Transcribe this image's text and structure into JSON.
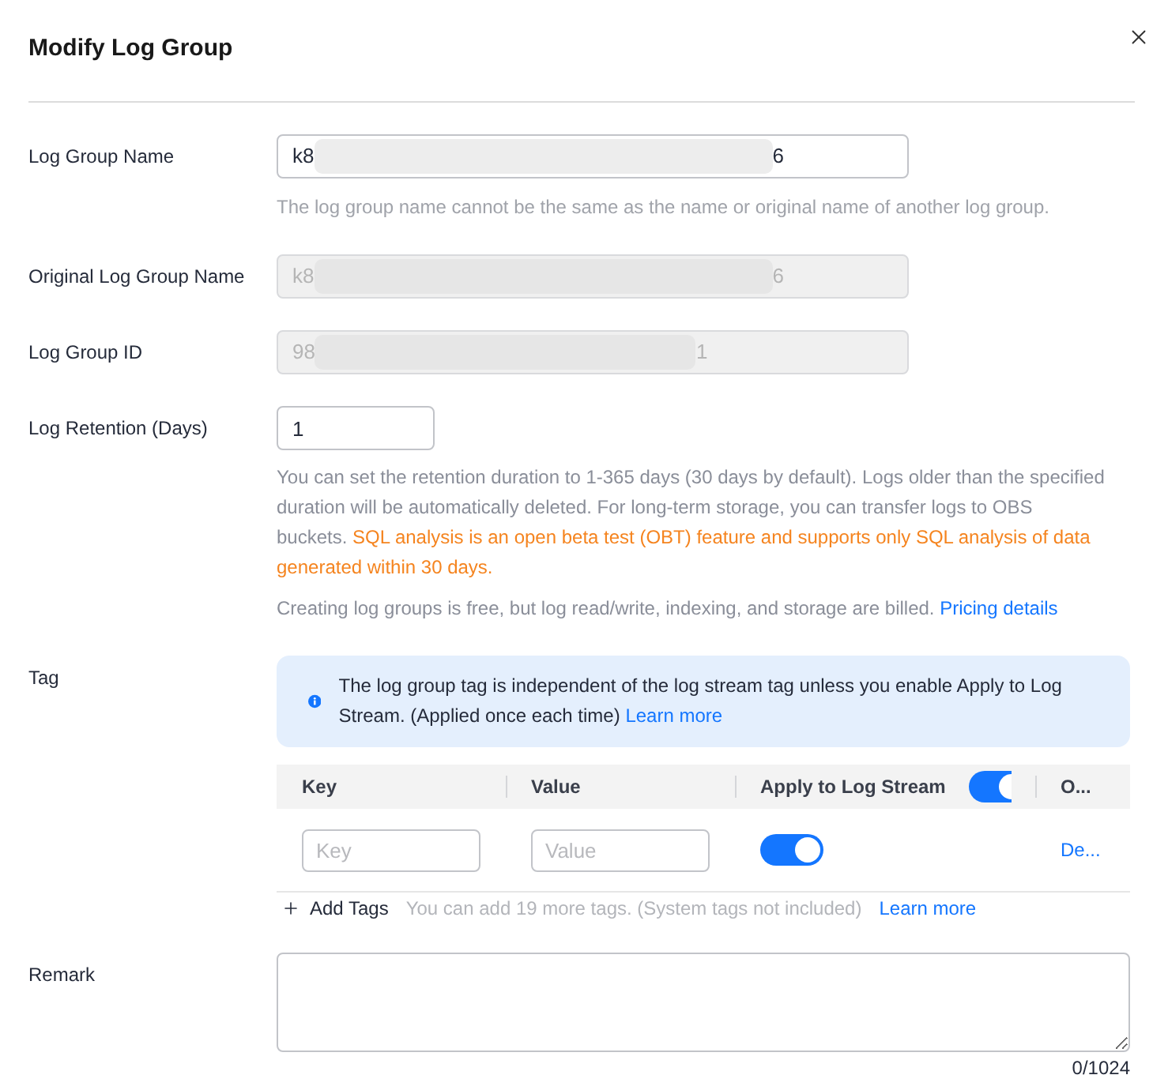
{
  "dialog": {
    "title": "Modify Log Group"
  },
  "fields": [
    {
      "kind": "text",
      "label": "Log Group Name",
      "value_start": "k8",
      "value_end": "6",
      "redacted": true,
      "disabled": false,
      "hint": "The log group name cannot be the same as the name or original name of another log group."
    },
    {
      "kind": "text",
      "label": "Original Log Group Name",
      "value_start": "k8",
      "value_end": "6",
      "redacted": true,
      "disabled": true
    },
    {
      "kind": "text",
      "label": "Log Group ID",
      "value_start": "98",
      "value_end": "1",
      "redacted": true,
      "disabled": true
    },
    {
      "kind": "number",
      "label": "Log Retention (Days)",
      "value": "1",
      "disabled": false,
      "help": [
        {
          "kind": "note",
          "text": "You can set the retention duration to 1-365 days (30 days by default). Logs older than the specified duration will be automatically deleted. For long-term storage, you can transfer logs to OBS"
        },
        {
          "kind": "break"
        },
        {
          "kind": "note",
          "text": "buckets."
        },
        {
          "kind": "warning",
          "text": "SQL analysis is an open beta test (OBT) feature and supports only SQL analysis of data generated within 30 days."
        }
      ],
      "notice": {
        "text": "Creating log groups is free, but log read/write, indexing, and storage are billed.",
        "link": "Pricing details"
      }
    }
  ],
  "tags": {
    "label": "Tag",
    "info": {
      "text": "The log group tag is independent of the log stream tag unless you enable Apply to Log Stream. (Applied once each time)",
      "link": "Learn more"
    },
    "columns": [
      {
        "label": "Key"
      },
      {
        "label": "Value"
      },
      {
        "label": "Apply to Log Stream",
        "toggle_on": true
      },
      {
        "label": "O..."
      }
    ],
    "rows": [
      {
        "key_placeholder": "Key",
        "value_placeholder": "Value",
        "apply_on": true,
        "action": "De..."
      }
    ],
    "add": {
      "label": "Add Tags",
      "note": "You can add 19 more tags. (System tags not included)",
      "link": "Learn more"
    }
  },
  "remark": {
    "label": "Remark",
    "counter": "0/1024"
  }
}
